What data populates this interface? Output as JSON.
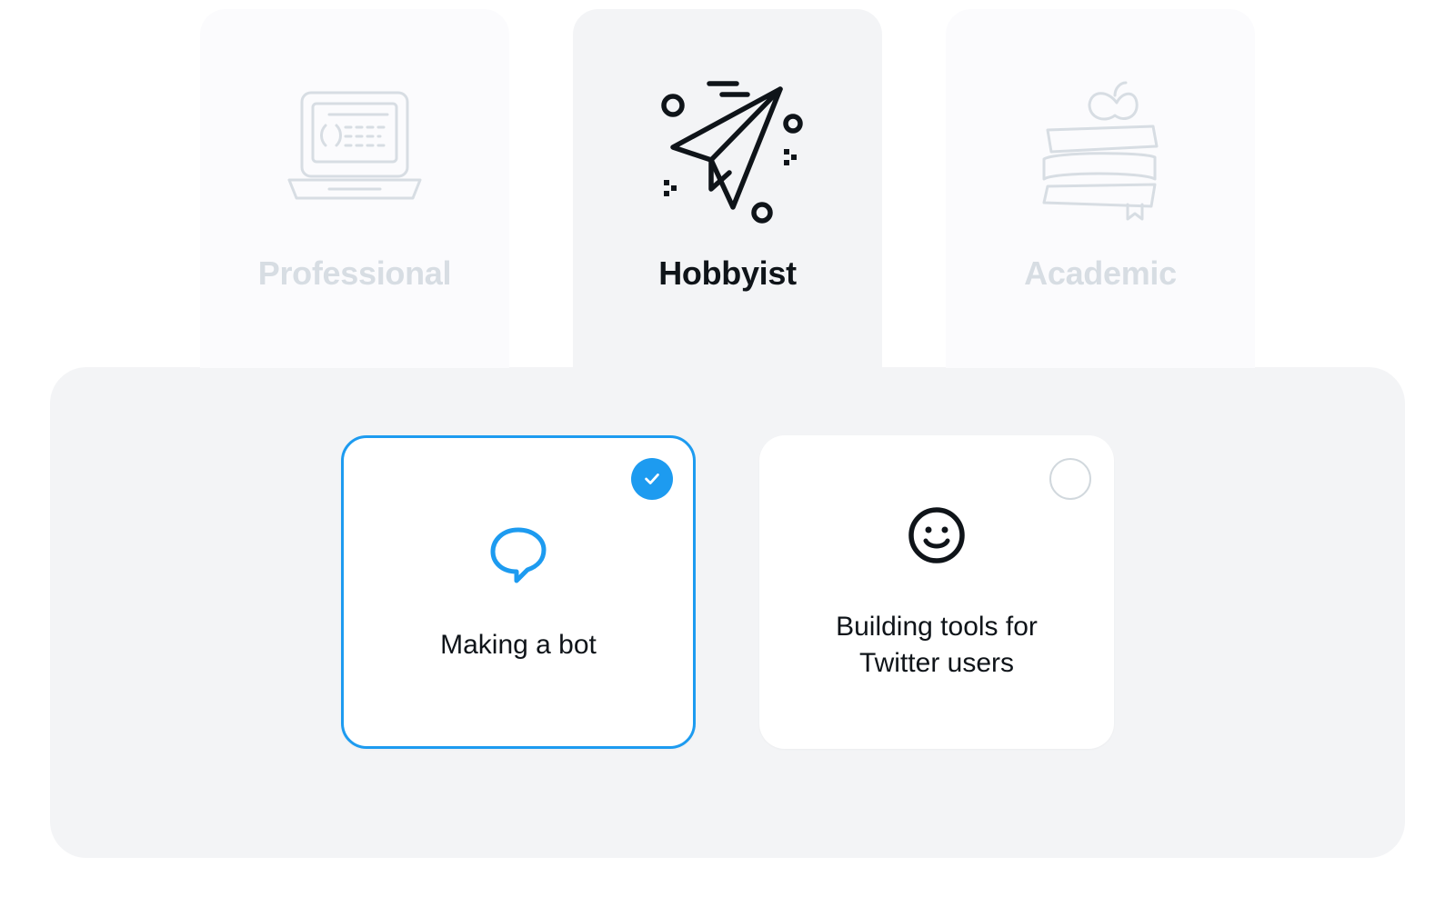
{
  "categories": [
    {
      "id": "professional",
      "label": "Professional",
      "active": false
    },
    {
      "id": "hobbyist",
      "label": "Hobbyist",
      "active": true
    },
    {
      "id": "academic",
      "label": "Academic",
      "active": false
    }
  ],
  "options": [
    {
      "id": "making-a-bot",
      "label": "Making a bot",
      "selected": true
    },
    {
      "id": "building-tools",
      "label": "Building tools for Twitter users",
      "selected": false
    }
  ],
  "colors": {
    "accent": "#1d9bf0",
    "muted": "#d7dde3",
    "panel_bg": "#f3f4f6",
    "text": "#0f1419"
  }
}
